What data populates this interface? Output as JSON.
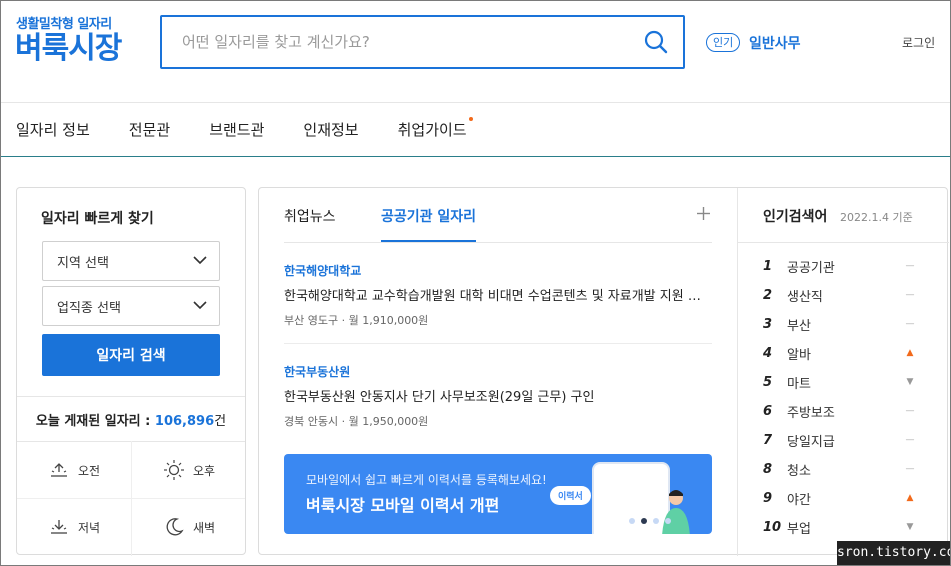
{
  "header": {
    "logo_sub": "생활밀착형 일자리",
    "logo_main": "벼룩시장",
    "search_placeholder": "어떤 일자리를 찾고 계신가요?",
    "popular_badge": "인기",
    "popular_word": "일반사무",
    "login": "로그인"
  },
  "nav": {
    "items": [
      "일자리 정보",
      "전문관",
      "브랜드관",
      "인재정보",
      "취업가이드"
    ]
  },
  "quick_find": {
    "title": "일자리 빠르게 찾기",
    "region_select": "지역 선택",
    "job_select": "업직종 선택",
    "search_button": "일자리 검색",
    "today_label": "오늘 게재된 일자리 :",
    "today_count": "106,896",
    "today_unit": "건",
    "times": [
      "오전",
      "오후",
      "저녁",
      "새벽"
    ]
  },
  "center": {
    "tabs": [
      "취업뉴스",
      "공공기관 일자리"
    ],
    "active_tab": 1,
    "jobs": [
      {
        "org": "한국해양대학교",
        "title": "한국해양대학교 교수학습개발원 대학 비대면 수업콘텐츠 및 자료개발 지원 전...",
        "meta": "부산 영도구 · 월 1,910,000원"
      },
      {
        "org": "한국부동산원",
        "title": "한국부동산원 안동지사 단기 사무보조원(29일 근무) 구인",
        "meta": "경북 안동시 · 월 1,950,000원"
      }
    ],
    "banner": {
      "line1": "모바일에서 쉽고 빠르게 이력서를 등록해보세요!",
      "line2": "벼룩시장 모바일 이력서 개편",
      "bubble": "이력서"
    }
  },
  "popular": {
    "title": "인기검색어",
    "date": "2022.1.4 기준",
    "items": [
      {
        "rank": "1",
        "word": "공공기관",
        "trend": "same"
      },
      {
        "rank": "2",
        "word": "생산직",
        "trend": "same"
      },
      {
        "rank": "3",
        "word": "부산",
        "trend": "same"
      },
      {
        "rank": "4",
        "word": "알바",
        "trend": "up"
      },
      {
        "rank": "5",
        "word": "마트",
        "trend": "down"
      },
      {
        "rank": "6",
        "word": "주방보조",
        "trend": "same"
      },
      {
        "rank": "7",
        "word": "당일지급",
        "trend": "same"
      },
      {
        "rank": "8",
        "word": "청소",
        "trend": "same"
      },
      {
        "rank": "9",
        "word": "야간",
        "trend": "up"
      },
      {
        "rank": "10",
        "word": "부업",
        "trend": "down"
      }
    ]
  },
  "watermark": "sron.tistory.com",
  "colors": {
    "brand": "#1a73d9",
    "accent_dot": "#f26a1b"
  }
}
